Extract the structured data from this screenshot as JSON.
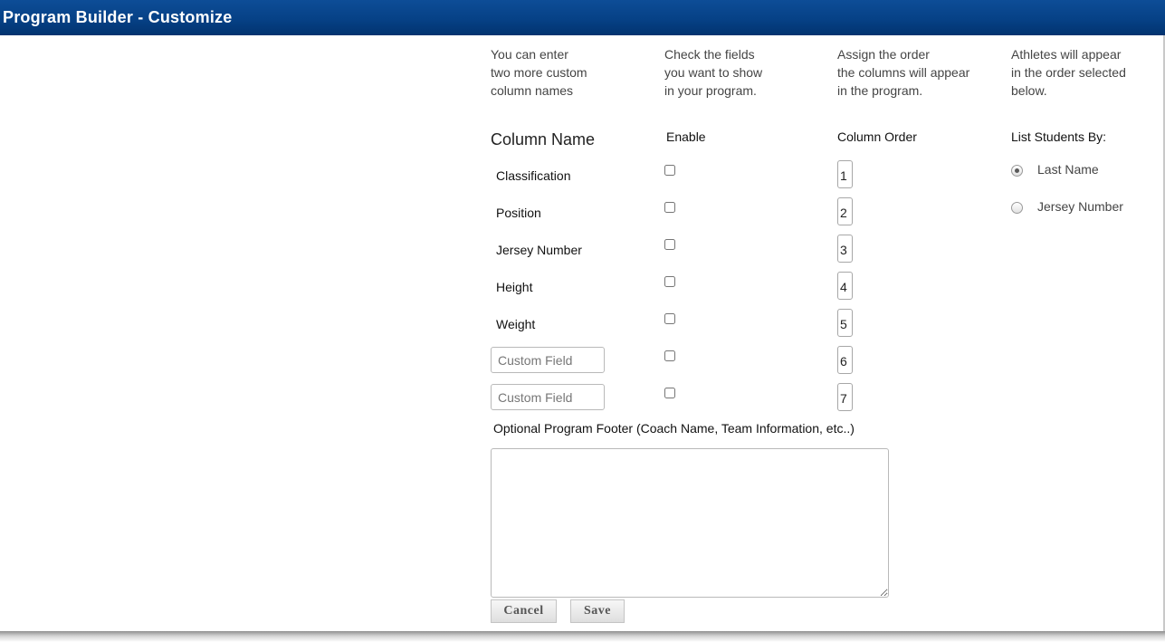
{
  "window": {
    "title": "Program Builder - Customize"
  },
  "intro": [
    {
      "lines": [
        "You can enter",
        "two more custom",
        "column names"
      ]
    },
    {
      "lines": [
        "Check the fields",
        "you want to show",
        "in your program."
      ]
    },
    {
      "lines": [
        "Assign the order",
        "the columns will appear",
        "in the program."
      ]
    },
    {
      "lines": [
        "Athletes will appear",
        "in the order selected",
        "below."
      ]
    }
  ],
  "headers": {
    "column_name": "Column Name",
    "enable": "Enable",
    "column_order": "Column Order",
    "list_by": "List Students By:"
  },
  "fields": [
    {
      "label": "Classification",
      "enabled": false,
      "order": "1"
    },
    {
      "label": "Position",
      "enabled": false,
      "order": "2"
    },
    {
      "label": "Jersey Number",
      "enabled": false,
      "order": "3"
    },
    {
      "label": "Height",
      "enabled": false,
      "order": "4"
    },
    {
      "label": "Weight",
      "enabled": false,
      "order": "5"
    },
    {
      "placeholder": "Custom Field",
      "value": "",
      "enabled": false,
      "order": "6"
    },
    {
      "placeholder": "Custom Field",
      "value": "",
      "enabled": false,
      "order": "7"
    }
  ],
  "list_options": [
    {
      "label": "Last Name",
      "selected": true
    },
    {
      "label": "Jersey Number",
      "selected": false
    }
  ],
  "footer": {
    "label": "Optional Program Footer (Coach Name, Team Information, etc..)",
    "value": ""
  },
  "buttons": {
    "cancel": "Cancel",
    "save": "Save"
  }
}
